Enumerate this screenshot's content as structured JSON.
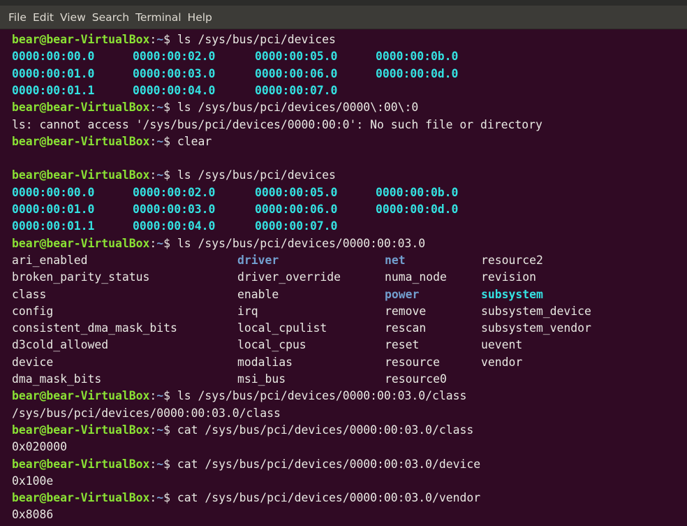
{
  "menu": [
    "File",
    "Edit",
    "View",
    "Search",
    "Terminal",
    "Help"
  ],
  "prompt": {
    "user": "bear@bear-VirtualBox",
    "sep": ":",
    "path": "~",
    "symbol": "$ "
  },
  "lines": [
    {
      "type": "cmd",
      "cmd": "ls /sys/bus/pci/devices"
    },
    {
      "type": "cols",
      "entries": [
        {
          "t": "0000:00:00.0",
          "c": "cyan"
        },
        {
          "t": "0000:00:02.0",
          "c": "cyan"
        },
        {
          "t": "0000:00:05.0",
          "c": "cyan"
        },
        {
          "t": "0000:00:0b.0",
          "c": "cyan"
        }
      ]
    },
    {
      "type": "cols",
      "entries": [
        {
          "t": "0000:00:01.0",
          "c": "cyan"
        },
        {
          "t": "0000:00:03.0",
          "c": "cyan"
        },
        {
          "t": "0000:00:06.0",
          "c": "cyan"
        },
        {
          "t": "0000:00:0d.0",
          "c": "cyan"
        }
      ]
    },
    {
      "type": "cols",
      "entries": [
        {
          "t": "0000:00:01.1",
          "c": "cyan"
        },
        {
          "t": "0000:00:04.0",
          "c": "cyan"
        },
        {
          "t": "0000:00:07.0",
          "c": "cyan"
        }
      ]
    },
    {
      "type": "cmd",
      "cmd": "ls /sys/bus/pci/devices/0000\\:00\\:0"
    },
    {
      "type": "text",
      "text": "ls: cannot access '/sys/bus/pci/devices/0000:00:0': No such file or directory"
    },
    {
      "type": "cmd",
      "cmd": "clear"
    },
    {
      "type": "blank"
    },
    {
      "type": "cmd",
      "cmd": "ls /sys/bus/pci/devices"
    },
    {
      "type": "cols",
      "entries": [
        {
          "t": "0000:00:00.0",
          "c": "cyan"
        },
        {
          "t": "0000:00:02.0",
          "c": "cyan"
        },
        {
          "t": "0000:00:05.0",
          "c": "cyan"
        },
        {
          "t": "0000:00:0b.0",
          "c": "cyan"
        }
      ]
    },
    {
      "type": "cols",
      "entries": [
        {
          "t": "0000:00:01.0",
          "c": "cyan"
        },
        {
          "t": "0000:00:03.0",
          "c": "cyan"
        },
        {
          "t": "0000:00:06.0",
          "c": "cyan"
        },
        {
          "t": "0000:00:0d.0",
          "c": "cyan"
        }
      ]
    },
    {
      "type": "cols",
      "entries": [
        {
          "t": "0000:00:01.1",
          "c": "cyan"
        },
        {
          "t": "0000:00:04.0",
          "c": "cyan"
        },
        {
          "t": "0000:00:07.0",
          "c": "cyan"
        }
      ]
    },
    {
      "type": "cmd",
      "cmd": "ls /sys/bus/pci/devices/0000:00:03.0"
    },
    {
      "type": "cols2",
      "entries": [
        {
          "t": "ari_enabled",
          "c": "plain"
        },
        {
          "t": "driver",
          "c": "dir"
        },
        {
          "t": "net",
          "c": "dir"
        },
        {
          "t": "resource2",
          "c": "plain"
        }
      ]
    },
    {
      "type": "cols2",
      "entries": [
        {
          "t": "broken_parity_status",
          "c": "plain"
        },
        {
          "t": "driver_override",
          "c": "plain"
        },
        {
          "t": "numa_node",
          "c": "plain"
        },
        {
          "t": "revision",
          "c": "plain"
        }
      ]
    },
    {
      "type": "cols2",
      "entries": [
        {
          "t": "class",
          "c": "plain"
        },
        {
          "t": "enable",
          "c": "plain"
        },
        {
          "t": "power",
          "c": "dir"
        },
        {
          "t": "subsystem",
          "c": "hl"
        }
      ]
    },
    {
      "type": "cols2",
      "entries": [
        {
          "t": "config",
          "c": "plain"
        },
        {
          "t": "irq",
          "c": "plain"
        },
        {
          "t": "remove",
          "c": "plain"
        },
        {
          "t": "subsystem_device",
          "c": "plain"
        }
      ]
    },
    {
      "type": "cols2",
      "entries": [
        {
          "t": "consistent_dma_mask_bits",
          "c": "plain"
        },
        {
          "t": "local_cpulist",
          "c": "plain"
        },
        {
          "t": "rescan",
          "c": "plain"
        },
        {
          "t": "subsystem_vendor",
          "c": "plain"
        }
      ]
    },
    {
      "type": "cols2",
      "entries": [
        {
          "t": "d3cold_allowed",
          "c": "plain"
        },
        {
          "t": "local_cpus",
          "c": "plain"
        },
        {
          "t": "reset",
          "c": "plain"
        },
        {
          "t": "uevent",
          "c": "plain"
        }
      ]
    },
    {
      "type": "cols2",
      "entries": [
        {
          "t": "device",
          "c": "plain"
        },
        {
          "t": "modalias",
          "c": "plain"
        },
        {
          "t": "resource",
          "c": "plain"
        },
        {
          "t": "vendor",
          "c": "plain"
        }
      ]
    },
    {
      "type": "cols2",
      "entries": [
        {
          "t": "dma_mask_bits",
          "c": "plain"
        },
        {
          "t": "msi_bus",
          "c": "plain"
        },
        {
          "t": "resource0",
          "c": "plain"
        }
      ]
    },
    {
      "type": "cmd",
      "cmd": "ls /sys/bus/pci/devices/0000:00:03.0/class"
    },
    {
      "type": "text",
      "text": "/sys/bus/pci/devices/0000:00:03.0/class"
    },
    {
      "type": "cmd",
      "cmd": "cat /sys/bus/pci/devices/0000:00:03.0/class"
    },
    {
      "type": "text",
      "text": "0x020000"
    },
    {
      "type": "cmd",
      "cmd": "cat /sys/bus/pci/devices/0000:00:03.0/device"
    },
    {
      "type": "text",
      "text": "0x100e"
    },
    {
      "type": "cmd",
      "cmd": "cat /sys/bus/pci/devices/0000:00:03.0/vendor"
    },
    {
      "type": "text",
      "text": "0x8086"
    }
  ],
  "colors": {
    "background": "#300a24",
    "menubar": "#3c3b37",
    "prompt_user": "#8ae234",
    "prompt_path": "#729fcf",
    "cyan": "#34e2e2",
    "text": "#e9e9e3"
  }
}
